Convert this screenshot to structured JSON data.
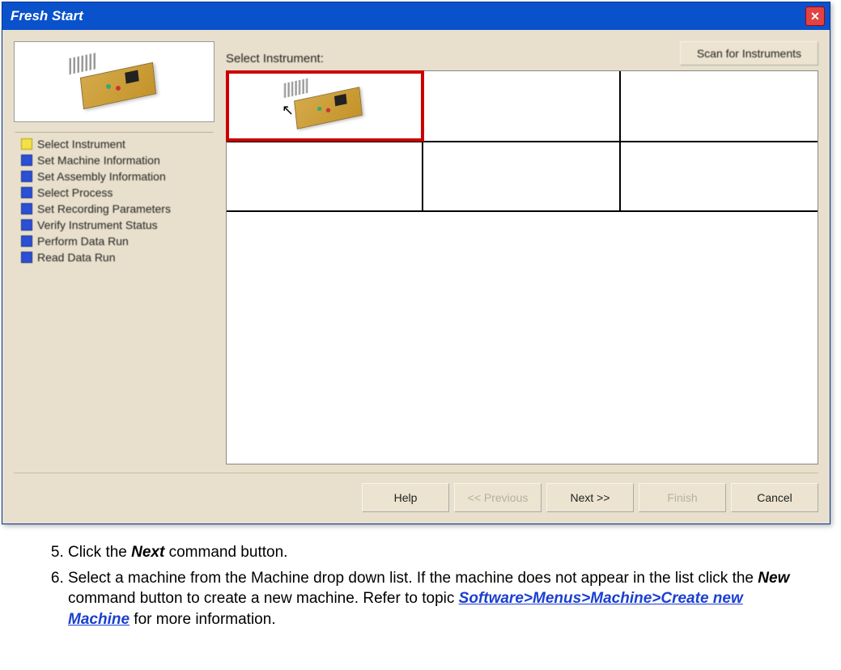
{
  "window": {
    "title": "Fresh Start"
  },
  "sidebar": {
    "steps": [
      {
        "label": "Select Instrument",
        "state": "yellow"
      },
      {
        "label": "Set Machine Information",
        "state": "blue"
      },
      {
        "label": "Set Assembly Information",
        "state": "blue"
      },
      {
        "label": "Select Process",
        "state": "blue"
      },
      {
        "label": "Set Recording Parameters",
        "state": "blue"
      },
      {
        "label": "Verify Instrument Status",
        "state": "blue"
      },
      {
        "label": "Perform Data Run",
        "state": "blue"
      },
      {
        "label": "Read Data Run",
        "state": "blue"
      }
    ]
  },
  "main": {
    "select_label": "Select Instrument:",
    "scan_button": "Scan for Instruments"
  },
  "buttons": {
    "help": "Help",
    "back": "<< Previous",
    "next": "Next >>",
    "finish": "Finish",
    "cancel": "Cancel"
  },
  "instructions": {
    "item5_num": "5)",
    "item5_a": "Click the ",
    "item5_bold": "Next",
    "item5_b": " command button.",
    "item6_num": "6)",
    "item6_a": "Select a machine from the Machine drop down list. If the machine does not appear in the list click the ",
    "item6_bold": "New",
    "item6_b": " command button to create a new machine. Refer to topic ",
    "item6_link": "Software>Menus>Machine>Create new Machine",
    "item6_c": " for more information."
  }
}
